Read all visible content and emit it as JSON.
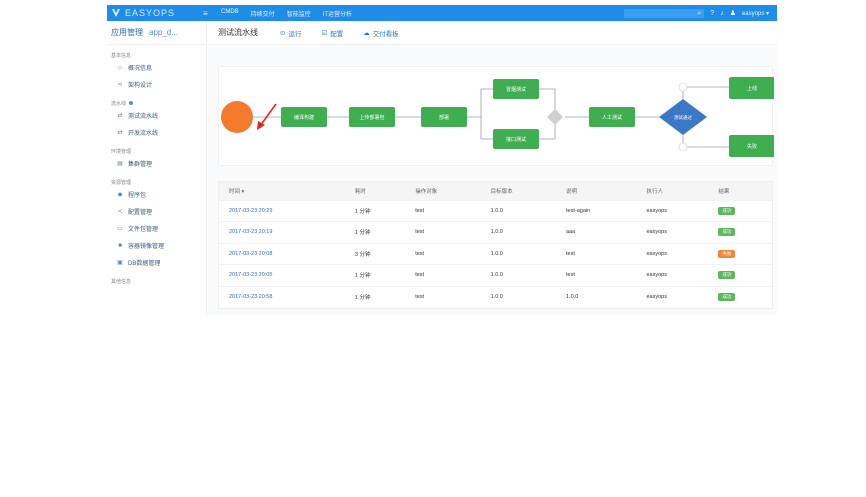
{
  "topbar": {
    "brand": "EASYOPS",
    "nav": [
      "CMDB",
      "持续交付",
      "智能监控",
      "IT运营分析"
    ],
    "user": "easyops ▾"
  },
  "sidebar": {
    "title": "应用管理",
    "app_name": "app_d...",
    "groups": [
      {
        "label": "基本信息",
        "items": [
          {
            "icon": "home-icon",
            "glyph": "⌂",
            "label": "概况信息"
          },
          {
            "icon": "share-icon",
            "glyph": "⋖",
            "label": "架构设计"
          }
        ]
      },
      {
        "label": "流水线",
        "items": [
          {
            "icon": "flow-icon",
            "glyph": "⇄",
            "label": "测试流水线"
          },
          {
            "icon": "flow-icon",
            "glyph": "⇄",
            "label": "开发流水线"
          }
        ]
      },
      {
        "label": "环境管理",
        "items": [
          {
            "icon": "server-icon",
            "glyph": "▤",
            "label": "集群管理"
          }
        ]
      },
      {
        "label": "资源管理",
        "items": [
          {
            "icon": "package-icon",
            "glyph": "◆",
            "label": "程序包"
          },
          {
            "icon": "config-icon",
            "glyph": "≺",
            "label": "配置管理"
          },
          {
            "icon": "doc-icon",
            "glyph": "▭",
            "label": "文件包管理"
          },
          {
            "icon": "image-icon",
            "glyph": "■",
            "label": "容器镜像管理"
          },
          {
            "icon": "db-icon",
            "glyph": "▣",
            "label": "DB数据管理"
          }
        ]
      },
      {
        "label": "其他信息",
        "items": []
      }
    ]
  },
  "main": {
    "title": "测试流水线",
    "actions": [
      {
        "icon": "play-icon",
        "glyph": "⊙",
        "label": "运行"
      },
      {
        "icon": "edit-icon",
        "glyph": "☑",
        "label": "配置"
      },
      {
        "icon": "report-icon",
        "glyph": "☁",
        "label": "交付看板"
      }
    ]
  },
  "flow": {
    "nodes": [
      "编译构建",
      "上传部署包",
      "部署",
      "冒烟测试",
      "接口测试",
      "人工测试",
      "测试通过",
      "上线",
      "失败"
    ],
    "colors": {
      "start": "#f47a2e",
      "step": "#3fae50",
      "decision": "#3b79c6",
      "gateway": "#cfcfcf"
    }
  },
  "table": {
    "headers": [
      "时间 ▾",
      "耗时",
      "操作对象",
      "目标版本",
      "说明",
      "执行人",
      "结果"
    ],
    "rows": [
      [
        "2017-03-23 20:29",
        "1 分钟",
        "test",
        "1.0.0",
        "test-again",
        "easyops",
        "成功"
      ],
      [
        "2017-03-23 20:19",
        "1 分钟",
        "test",
        "1.0.0",
        "aaa",
        "easyops",
        "成功"
      ],
      [
        "2017-03-23 20:08",
        "3 分钟",
        "test",
        "1.0.0",
        "test",
        "easyops",
        "失败"
      ],
      [
        "2017-03-23 20:05",
        "1 分钟",
        "test",
        "1.0.0",
        "test",
        "easyops",
        "成功"
      ],
      [
        "2017-03-23 20:58",
        "1 分钟",
        "test",
        "1.0.0",
        "1.0.0",
        "easyops",
        "成功"
      ]
    ],
    "result_colors": {
      "成功": "#5cb85c",
      "失败": "#f0883a"
    }
  }
}
